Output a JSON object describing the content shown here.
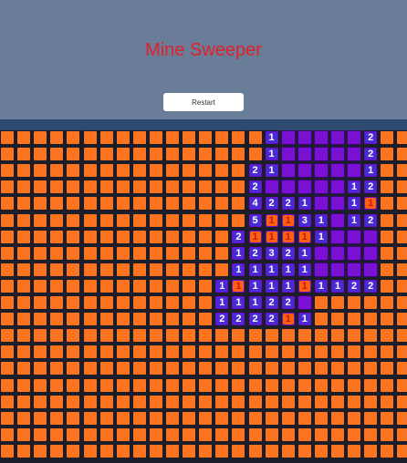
{
  "game": {
    "title": "Mine Sweeper",
    "restart_label": "Restart"
  },
  "board": {
    "cols": 25,
    "rows": 20,
    "colors": {
      "hidden": "#fc7320",
      "open": "#7a10d4",
      "number_text": "#ffffff",
      "red_number_text": "#c21818"
    },
    "grid": [
      "................1.....2..",
      "................1.....2..",
      "...............21.....1..",
      "...............2.....12..",
      "...............4221..1R..",
      "...............5RR31.12..",
      "..............2RRRR1...1.",
      "..............12321....1.",
      "..............11111....1.",
      ".............1R111R11221.",
      ".............11122.......",
      ".............2222R1......",
      ".........................",
      ".........................",
      ".........................",
      ".........................",
      ".........................",
      ".........................",
      ".........................",
      "........................."
    ],
    "open_mask": [
      "................OOOOOOO..",
      "................OOOOOOO..",
      "...............OOOOOOOO..",
      "...............OOOOOOOO..",
      "...............OOOOOOOO..",
      "...............OOOOOOOO..",
      "..............OOOOOOOOO..",
      "..............OOOOOOOOO..",
      "..............OOOOOOOOO..",
      ".............OOOOOOOOOO..",
      ".............OOOOOO......",
      ".............OOOOOO......",
      ".........................",
      ".........................",
      ".........................",
      ".........................",
      ".........................",
      ".........................",
      ".........................",
      "........................."
    ]
  }
}
